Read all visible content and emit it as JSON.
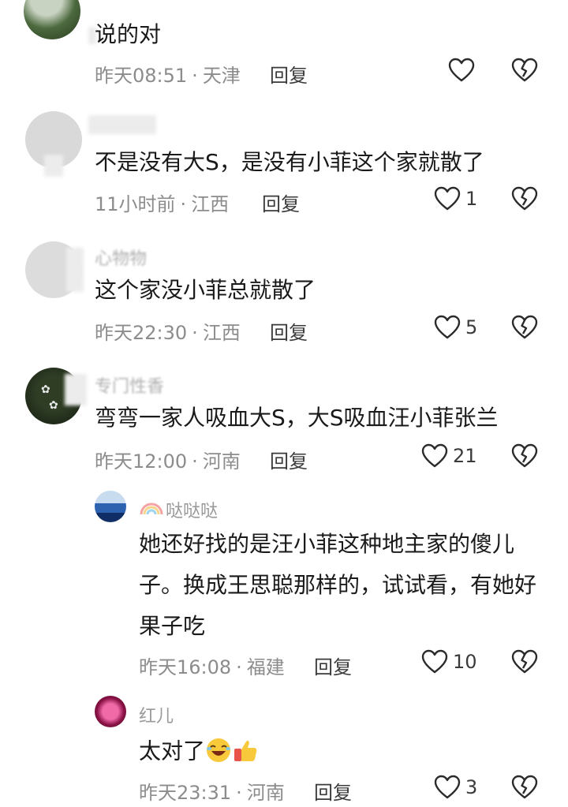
{
  "comments": [
    {
      "name": "",
      "text": "说的对",
      "time": "昨天08:51",
      "region": "天津",
      "reply": "回复",
      "likes": ""
    },
    {
      "name": "",
      "text": "不是没有大S，是没有小菲这个家就散了",
      "time": "11小时前",
      "region": "江西",
      "reply": "回复",
      "likes": "1"
    },
    {
      "name": "心物物",
      "text": "这个家没小菲总就散了",
      "time": "昨天22:30",
      "region": "江西",
      "reply": "回复",
      "likes": "5"
    },
    {
      "name": "专门性香",
      "text": "弯弯一家人吸血大S，大S吸血汪小菲张兰",
      "time": "昨天12:00",
      "region": "河南",
      "reply": "回复",
      "likes": "21"
    },
    {
      "name": "哒哒哒",
      "text": "她还好找的是汪小菲这种地主家的傻儿子。换成王思聪那样的，试试看，有她好果子吃",
      "time": "昨天16:08",
      "region": "福建",
      "reply": "回复",
      "likes": "10"
    },
    {
      "name": "红儿",
      "text": "太对了",
      "time": "昨天23:31",
      "region": "河南",
      "reply": "回复",
      "likes": "3"
    }
  ],
  "separator": "·",
  "icons": {
    "like": "heart-outline-icon",
    "dislike": "broken-heart-icon",
    "rainbow": "rainbow-icon"
  }
}
